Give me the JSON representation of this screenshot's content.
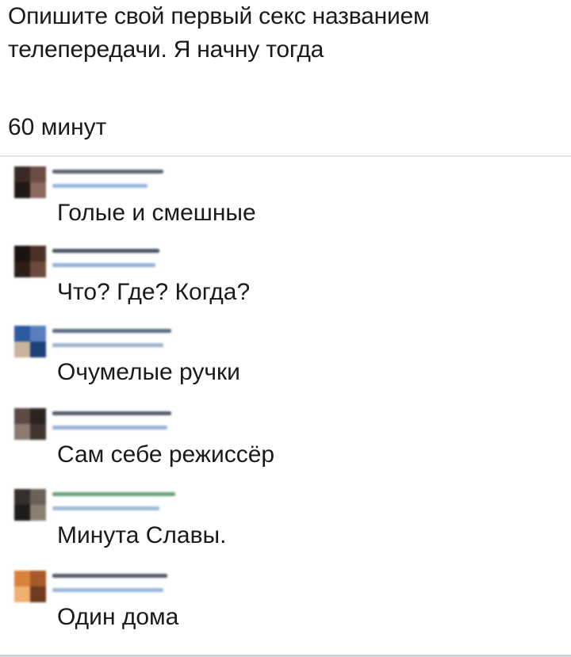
{
  "post": {
    "text": "Опишите свой первый секс названием телепередачи. Я начну тогда",
    "reply": "60 минут"
  },
  "comments": [
    {
      "text": "Голые и смешные",
      "avatar_colors": [
        "#3a2a25",
        "#6b4d44",
        "#1f1714",
        "#8a6a5e"
      ],
      "name_color": "#5c6470",
      "meta_color": "#9ab6dc"
    },
    {
      "text": "Что? Где? Когда?",
      "avatar_colors": [
        "#1b1310",
        "#4a3028",
        "#2c1d18",
        "#6d4a3e"
      ],
      "name_color": "#4b5260",
      "meta_color": "#93b0d8"
    },
    {
      "text": "Очумелые ручки",
      "avatar_colors": [
        "#2d5aa0",
        "#5a7fbf",
        "#c8b49c",
        "#1e3f78"
      ],
      "name_color": "#5a6b84",
      "meta_color": "#9fb3cc"
    },
    {
      "text": "Сам себе режиссёр",
      "avatar_colors": [
        "#5c4b45",
        "#2b2420",
        "#8c7a72",
        "#40342f"
      ],
      "name_color": "#555d6a",
      "meta_color": "#9ab0d4"
    },
    {
      "text": "Минута Славы.",
      "avatar_colors": [
        "#33302c",
        "#6a6258",
        "#1e1c1a",
        "#8a8072"
      ],
      "name_color": "#6aa37a",
      "meta_color": "#9fbad8"
    },
    {
      "text": "Один дома",
      "avatar_colors": [
        "#d9823c",
        "#a45a2a",
        "#f0b070",
        "#6e3b1c"
      ],
      "name_color": "#555d6a",
      "meta_color": "#9ab6dc"
    }
  ]
}
